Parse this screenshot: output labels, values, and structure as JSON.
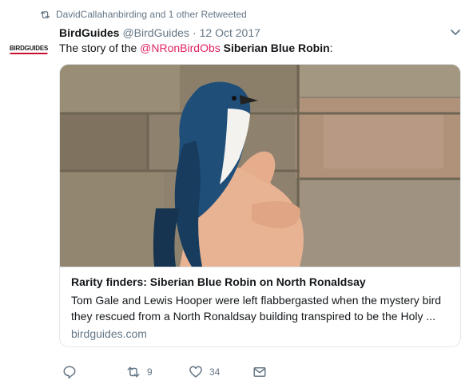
{
  "retweet_context": {
    "icon": "retweet-icon",
    "text": "DavidCallahanbirding and 1 other Retweeted"
  },
  "author": {
    "display_name": "BirdGuides",
    "handle": "@BirdGuides",
    "separator": "·",
    "date": "12 Oct 2017",
    "avatar_logo_text": "BIRDGUIDES"
  },
  "tweet": {
    "text_prefix": "The story of the ",
    "mention": "@NRonBirdObs",
    "text_middle_space": " ",
    "bold_text": "Siberian Blue Robin",
    "text_suffix": ":"
  },
  "card": {
    "image_alt": "Siberian Blue Robin held in hand against stone wall",
    "title": "Rarity finders: Siberian Blue Robin on North Ronaldsay",
    "description": "Tom Gale and Lewis Hooper were left flabbergasted when the mystery bird they rescued from a North Ronaldsay building transpired to be the Holy ...",
    "domain": "birdguides.com"
  },
  "actions": {
    "reply": {
      "icon": "reply-icon",
      "count": ""
    },
    "retweet": {
      "icon": "retweet-icon",
      "count": "9"
    },
    "like": {
      "icon": "heart-icon",
      "count": "34"
    },
    "message": {
      "icon": "envelope-icon",
      "count": ""
    }
  },
  "colors": {
    "mention": "#e0245e",
    "secondary_text": "#657786",
    "border": "#e1e8ed"
  }
}
